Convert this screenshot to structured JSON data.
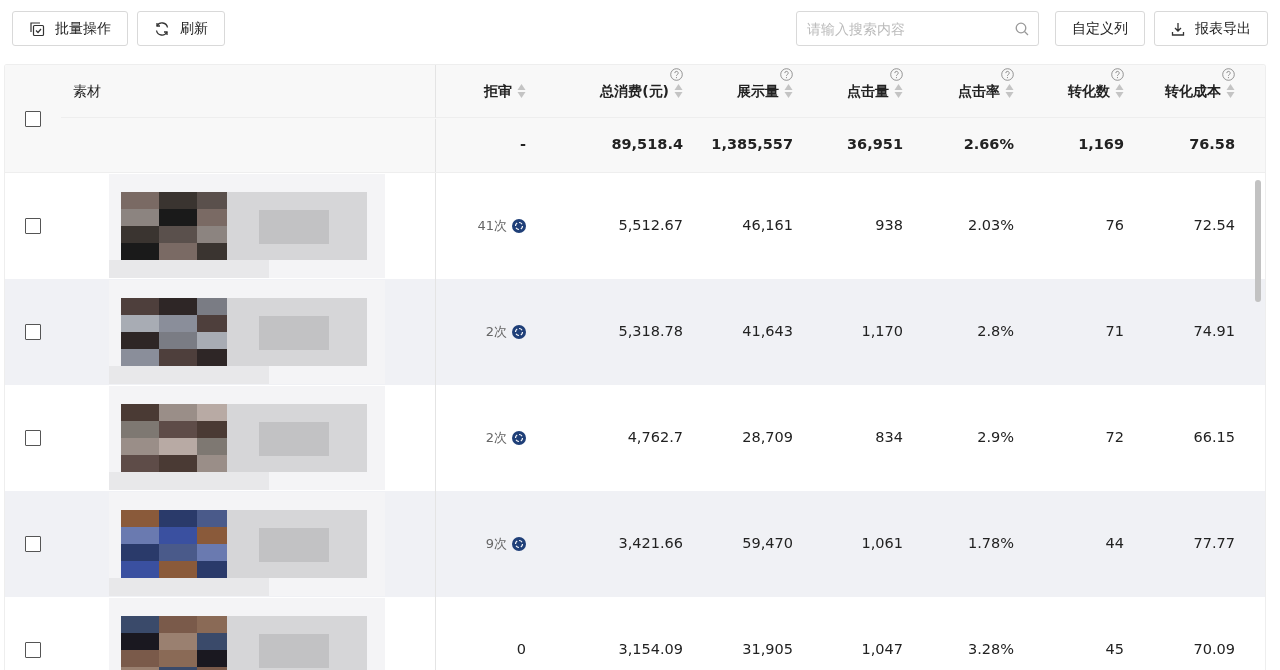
{
  "toolbar": {
    "batch_button": "批量操作",
    "refresh_button": "刷新",
    "search": {
      "placeholder": "请输入搜索内容"
    },
    "columns_button": "自定义列",
    "export_button": "报表导出"
  },
  "table": {
    "header_checkbox": {
      "checked": false
    },
    "material_column": "素材",
    "columns": [
      {
        "label": "拒审",
        "sortable": true,
        "help": false
      },
      {
        "label": "总消费(元)",
        "sortable": true,
        "help": true
      },
      {
        "label": "展示量",
        "sortable": true,
        "help": true
      },
      {
        "label": "点击量",
        "sortable": true,
        "help": true
      },
      {
        "label": "点击率",
        "sortable": true,
        "help": true
      },
      {
        "label": "转化数",
        "sortable": true,
        "help": true
      },
      {
        "label": "转化成本",
        "sortable": true,
        "help": true
      }
    ],
    "totals": [
      "-",
      "89,518.4",
      "1,385,557",
      "36,951",
      "2.66%",
      "1,169",
      "76.58"
    ],
    "rows": [
      {
        "checked": false,
        "rejection_icon": true,
        "cells": [
          "41次",
          "5,512.67",
          "46,161",
          "938",
          "2.03%",
          "76",
          "72.54"
        ]
      },
      {
        "checked": false,
        "rejection_icon": true,
        "cells": [
          "2次",
          "5,318.78",
          "41,643",
          "1,170",
          "2.8%",
          "71",
          "74.91"
        ]
      },
      {
        "checked": false,
        "rejection_icon": true,
        "cells": [
          "2次",
          "4,762.7",
          "28,709",
          "834",
          "2.9%",
          "72",
          "66.15"
        ]
      },
      {
        "checked": false,
        "rejection_icon": true,
        "cells": [
          "9次",
          "3,421.66",
          "59,470",
          "1,061",
          "1.78%",
          "44",
          "77.77"
        ]
      },
      {
        "checked": false,
        "rejection_icon": false,
        "cells": [
          "0",
          "3,154.09",
          "31,905",
          "1,047",
          "3.28%",
          "45",
          "70.09"
        ]
      }
    ]
  }
}
